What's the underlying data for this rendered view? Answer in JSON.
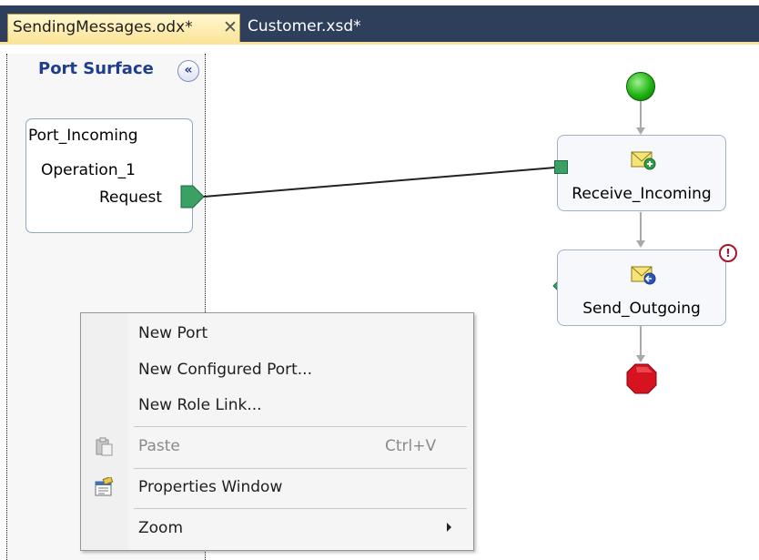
{
  "tabs": {
    "active": "SendingMessages.odx*",
    "close_glyph": "✕",
    "inactive": "Customer.xsd*"
  },
  "port_surface": {
    "title": "Port Surface",
    "collapse_glyph": "«",
    "port": {
      "name": "Port_Incoming",
      "operation": "Operation_1",
      "request": "Request"
    }
  },
  "orchestration": {
    "receive_label": "Receive_Incoming",
    "send_label": "Send_Outgoing",
    "warning_glyph": "!"
  },
  "context_menu": {
    "items": [
      {
        "label": "New Port"
      },
      {
        "label": "New Configured Port..."
      },
      {
        "label": "New Role Link..."
      },
      {
        "label": "Paste",
        "shortcut": "Ctrl+V",
        "disabled": true,
        "icon": "paste-icon"
      },
      {
        "label": "Properties Window",
        "icon": "properties-icon"
      },
      {
        "label": "Zoom",
        "submenu": true
      }
    ]
  },
  "colors": {
    "tab_strip": "#2e3f5c",
    "active_tab": "#fbe59a",
    "port_green": "#3ba063",
    "start_green": "#1fb312",
    "stop_red": "#d6131f"
  }
}
